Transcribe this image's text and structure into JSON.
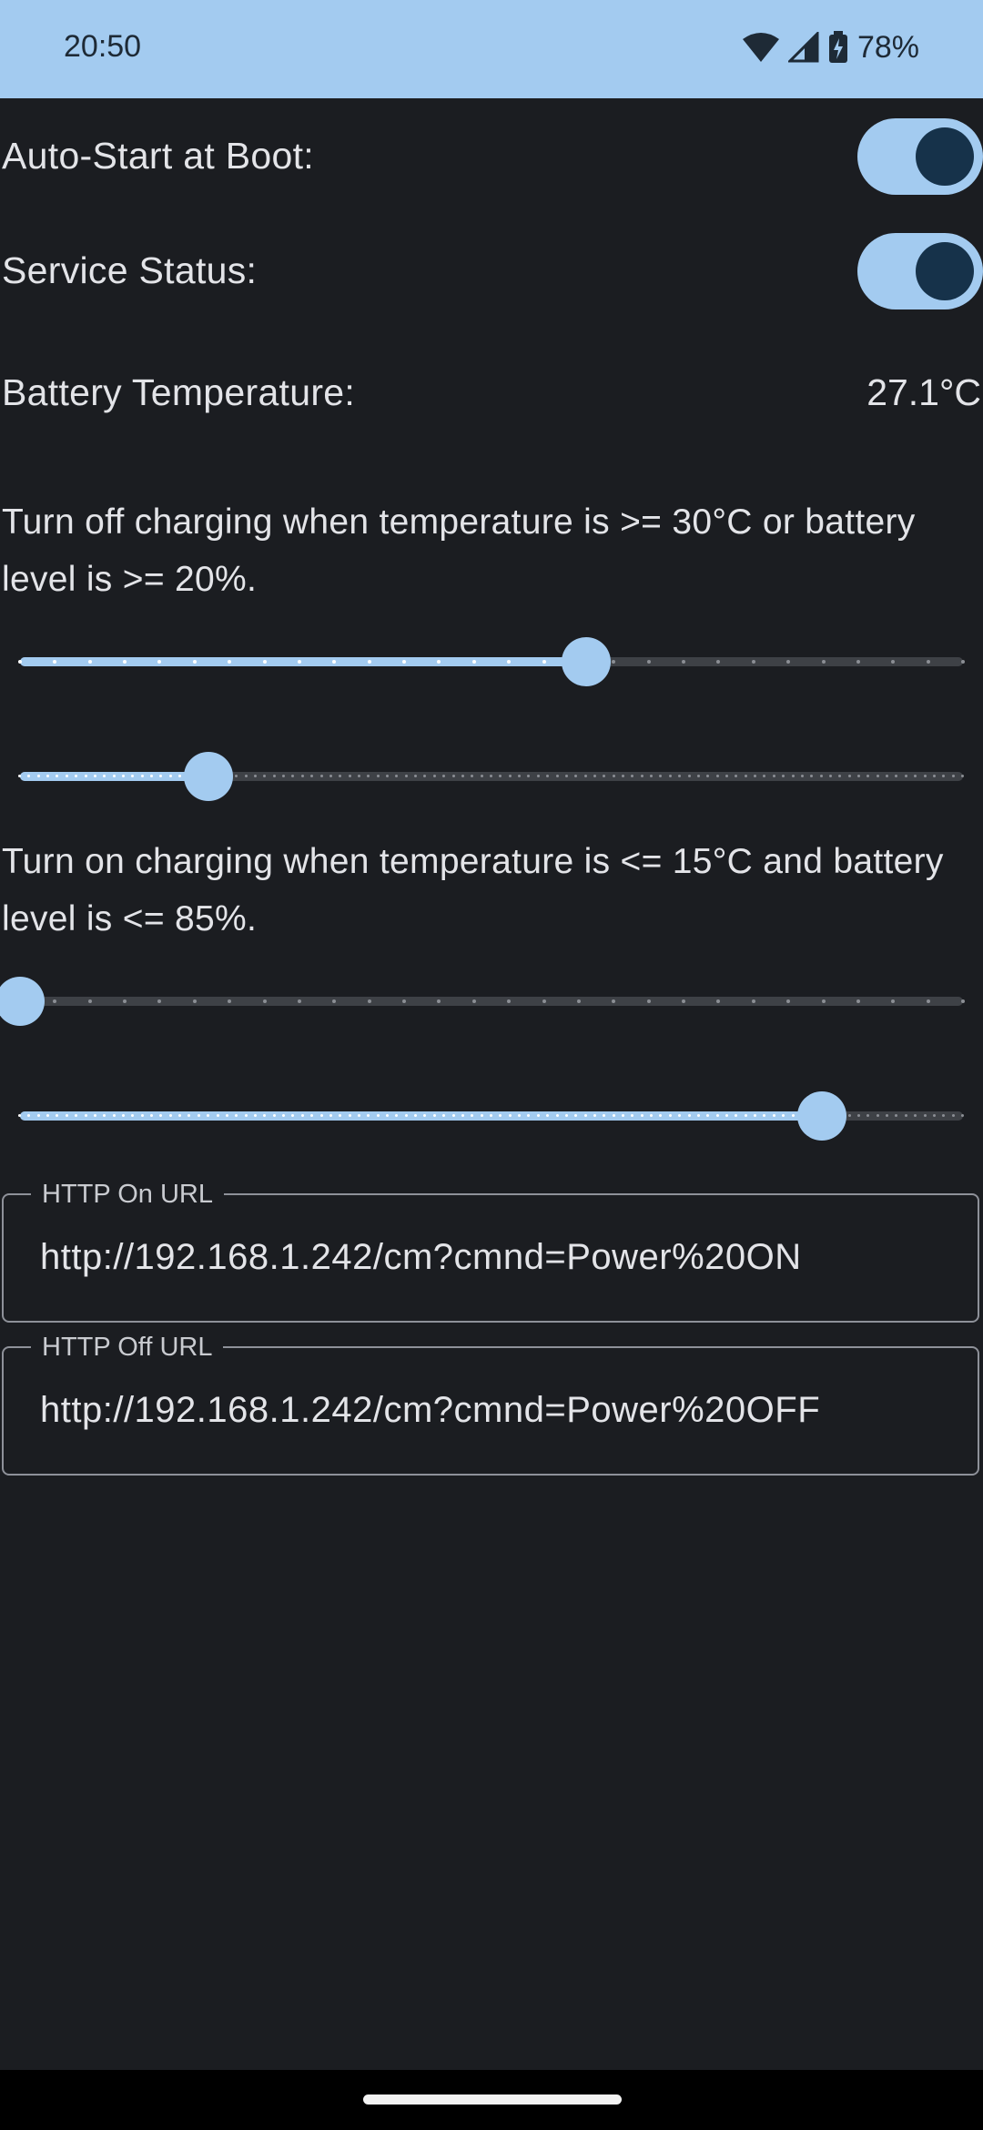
{
  "status_bar": {
    "time": "20:50",
    "battery_percent": "78%",
    "icons": [
      "wifi-icon",
      "cell-signal-icon",
      "battery-charging-icon"
    ]
  },
  "settings": {
    "auto_start_label": "Auto-Start at Boot:",
    "auto_start_on": true,
    "service_status_label": "Service Status:",
    "service_status_on": true,
    "battery_temp_label": "Battery Temperature:",
    "battery_temp_value": "27.1°C"
  },
  "turn_off": {
    "text": "Turn off charging when temperature is >= 30°C or battery level is >= 20%.",
    "temp_slider": {
      "value_fraction": 0.6,
      "steps": 27,
      "dotted": false
    },
    "level_slider": {
      "value_fraction": 0.2,
      "steps": 100,
      "dotted": true
    }
  },
  "turn_on": {
    "text": "Turn on charging when temperature is <= 15°C and battery level is <= 85%.",
    "temp_slider": {
      "value_fraction": 0.0,
      "steps": 27,
      "dotted": false
    },
    "level_slider": {
      "value_fraction": 0.85,
      "steps": 100,
      "dotted": true
    }
  },
  "http_on": {
    "label": "HTTP On URL",
    "value": "http://192.168.1.242/cm?cmnd=Power%20ON"
  },
  "http_off": {
    "label": "HTTP Off URL",
    "value": "http://192.168.1.242/cm?cmnd=Power%20OFF"
  },
  "colors": {
    "accent": "#a3cbf0",
    "background": "#1b1d21",
    "knob": "#16324a",
    "track_inactive": "#3e4146"
  }
}
